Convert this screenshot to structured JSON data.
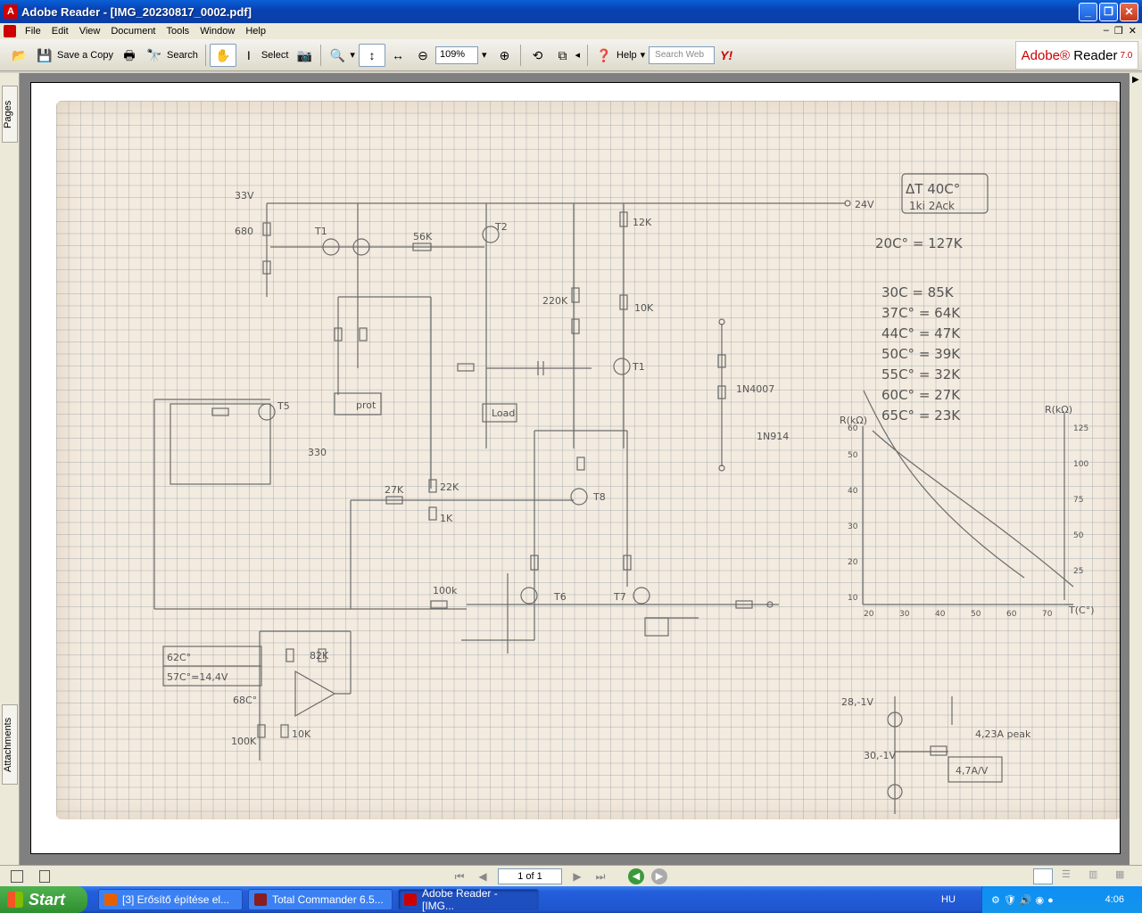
{
  "window": {
    "title": "Adobe Reader - [IMG_20230817_0002.pdf]"
  },
  "menu": [
    "File",
    "Edit",
    "View",
    "Document",
    "Tools",
    "Window",
    "Help"
  ],
  "toolbar": {
    "save_copy": "Save a Copy",
    "search": "Search",
    "select": "Select",
    "zoom_value": "109%",
    "help": "Help",
    "search_web_placeholder": "Search Web",
    "brand_adobe": "Adobe",
    "brand_reader": "Reader",
    "brand_version": "7.0"
  },
  "left_tabs": {
    "pages": "Pages",
    "attachments": "Attachments"
  },
  "bottom": {
    "page_indicator": "1 of 1"
  },
  "document": {
    "notes": {
      "box_title": "ΔT 40C°",
      "box_sub": "1ki 2Ack",
      "r20": "20C° = 127K",
      "r30": "30C = 85K",
      "r37": "37C° = 64K",
      "r44": "44C° = 47K",
      "r50": "50C° = 39K",
      "r55": "55C° = 32K",
      "r60": "60C° = 27K",
      "r65": "65C° = 23K"
    },
    "labels": {
      "v33": "33V",
      "v24": "24V",
      "t1": "T1",
      "t2": "T2",
      "t1b": "T1",
      "t5": "T5",
      "t6": "T6",
      "t7": "T7",
      "t8": "T8",
      "r12k": "12K",
      "r56k": "56K",
      "r680": "680",
      "r220k": "220K",
      "r10k": "10K",
      "r27k": "27K",
      "r22k": "22K",
      "r1k": "1K",
      "r100k": "100k",
      "r330": "330",
      "prot": "prot",
      "load": "Load",
      "d4007": "1N4007",
      "d914": "1N914",
      "c62": "62C°",
      "c57": "57C°=14,4V",
      "r82k": "82K",
      "c68": "68C°",
      "r10kb": "10K",
      "r100kb": "100K",
      "i_peak": "4,23A peak",
      "amp_v": "4,7A/V",
      "v28": "28,-1V",
      "v30": "30,-1V",
      "tc": "T(C°)",
      "rk": "R(kΩ)"
    }
  }
}
